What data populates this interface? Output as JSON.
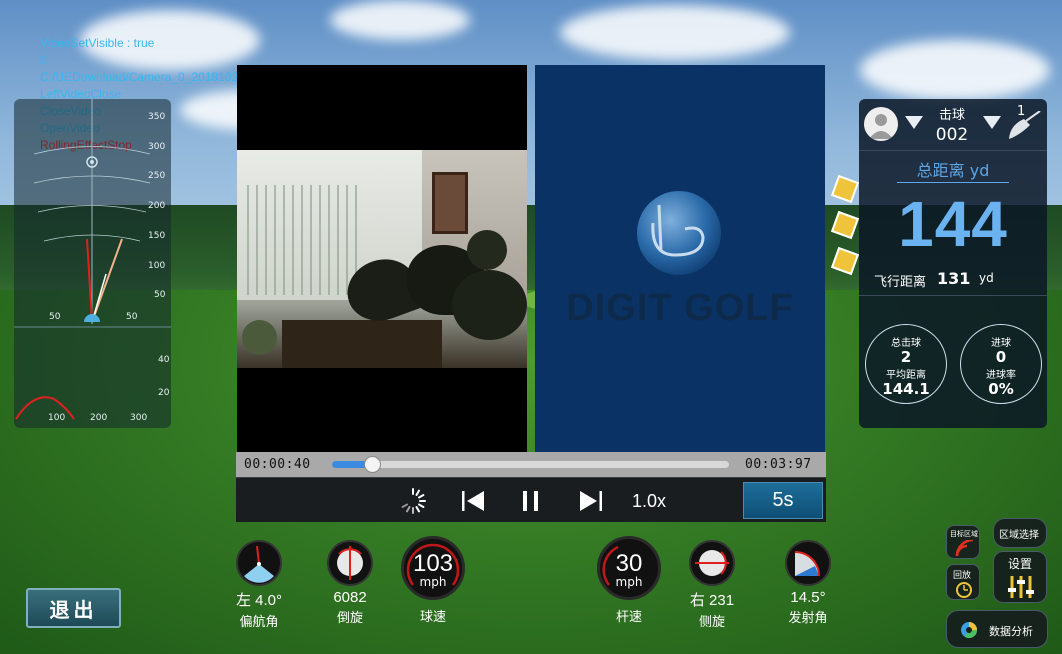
{
  "debug": {
    "lines": [
      {
        "text": "VideoSetVisible : true",
        "color": "#35b8f0"
      },
      {
        "text": "6",
        "color": "#35b8f0"
      },
      {
        "text": "C:/UEDownload/Camera_0_20181021114218.mp4",
        "color": "#35b8f0"
      },
      {
        "text": "LeftVideoClose",
        "color": "#35b8f0"
      },
      {
        "text": "CloseVideo",
        "color": "#35b8f0"
      },
      {
        "text": "OpenVideo",
        "color": "#35b8f0"
      },
      {
        "text": "RollingEffectStop",
        "color": "#ff2a2a"
      }
    ]
  },
  "trajectory": {
    "top_view_ticks": [
      "350",
      "300",
      "250",
      "200",
      "150",
      "100",
      "50"
    ],
    "side_labels": [
      "50",
      "50"
    ],
    "side_view_y_ticks": [
      "40",
      "20"
    ],
    "side_view_x_ticks": [
      "100",
      "200",
      "300"
    ]
  },
  "video": {
    "brand_text": "DIGIT GOLF",
    "current_time": "00:00:40",
    "total_time": "00:03:97",
    "progress_fraction": 0.1,
    "speed": "1.0x",
    "skip_label": "5s"
  },
  "stats": {
    "shot_label": "击球",
    "shot_number": "002",
    "club_number": "1",
    "total_distance_label": "总距离 yd",
    "total_distance": "144",
    "carry_label": "飞行距离",
    "carry_value": "131",
    "carry_unit": "yd",
    "circles": [
      {
        "l1": "总击球",
        "v1": "2",
        "l2": "平均距离",
        "v2": "144.1"
      },
      {
        "l1": "进球",
        "v1": "0",
        "l2": "进球率",
        "v2": "0%"
      }
    ]
  },
  "gauges": {
    "heading": {
      "value": "左 4.0°",
      "name": "偏航角"
    },
    "backspin": {
      "value": "6082",
      "name": "倒旋"
    },
    "ball_speed": {
      "value": "103",
      "unit": "mph",
      "name": "球速"
    },
    "club_speed": {
      "value": "30",
      "unit": "mph",
      "name": "杆速"
    },
    "sidespin": {
      "value": "右 231",
      "name": "侧旋"
    },
    "launch_angle": {
      "value": "14.5°",
      "name": "发射角"
    }
  },
  "buttons": {
    "exit": "退出",
    "area_select": "区域选择",
    "target_area": "目标区域",
    "replay": "回放",
    "settings": "设置",
    "data_analysis": "数据分析"
  },
  "colors": {
    "accent_blue": "#6ab2f0",
    "progress_blue": "#3a8be0",
    "debug_cyan": "#35b8f0",
    "debug_red": "#ff2a2a",
    "right_video_bg": "#0a3264"
  }
}
